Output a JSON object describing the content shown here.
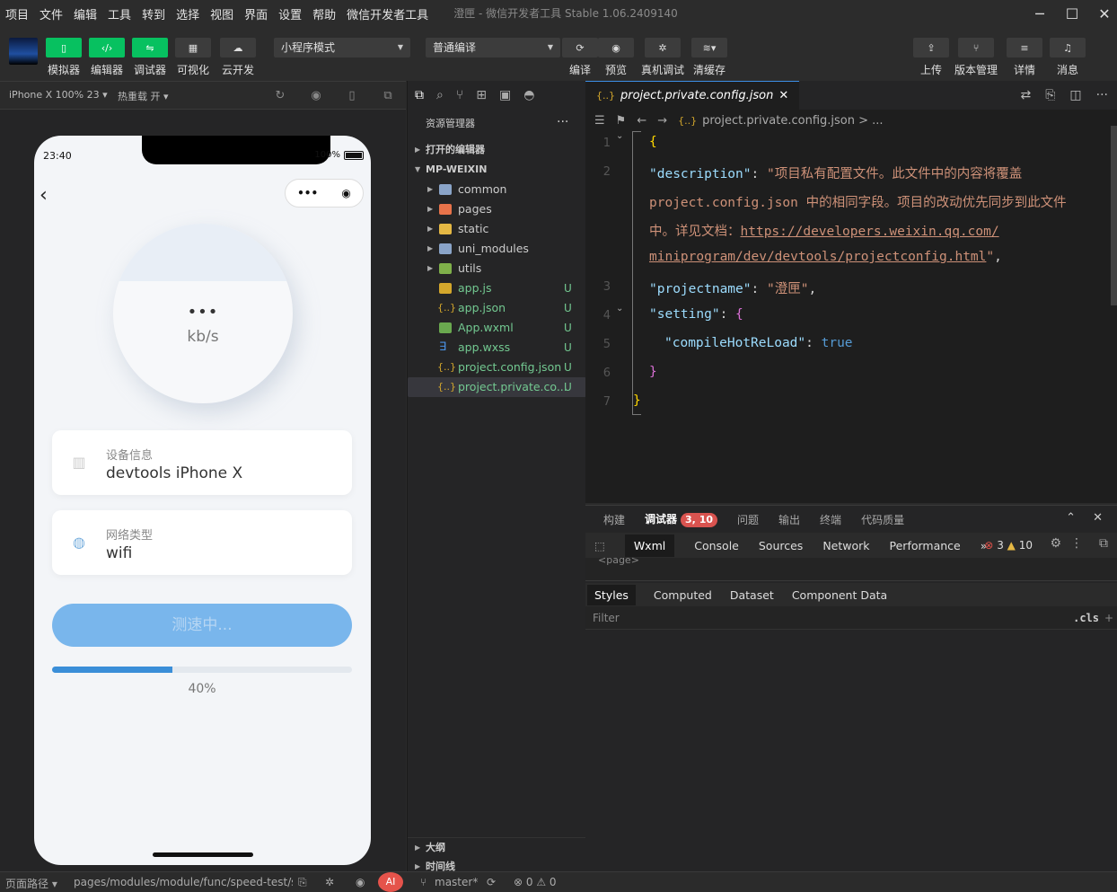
{
  "menu": [
    "项目",
    "文件",
    "编辑",
    "工具",
    "转到",
    "选择",
    "视图",
    "界面",
    "设置",
    "帮助",
    "微信开发者工具"
  ],
  "window_title": "澄匣 - 微信开发者工具 Stable 1.06.2409140",
  "toolbar": {
    "buttons": [
      "模拟器",
      "编辑器",
      "调试器",
      "可视化",
      "云开发"
    ],
    "mode_select": "小程序模式",
    "compile_select": "普通编译",
    "actions": [
      "编译",
      "预览",
      "真机调试",
      "清缓存"
    ],
    "right_actions": [
      "上传",
      "版本管理",
      "详情",
      "消息"
    ]
  },
  "simulator": {
    "device": "iPhone X 100% 23 ▾",
    "hotreload": "热重载 开 ▾"
  },
  "phone": {
    "time": "23:40",
    "battery": "100%",
    "speed_value": "•••",
    "speed_unit": "kb/s",
    "device_label": "设备信息",
    "device_value": "devtools iPhone X",
    "network_label": "网络类型",
    "network_value": "wifi",
    "test_button": "测速中...",
    "progress": 0.4,
    "progress_text": "40%"
  },
  "explorer": {
    "header": "资源管理器",
    "open_editors": "打开的编辑器",
    "project": "MP-WEIXIN",
    "folders": [
      "common",
      "pages",
      "static",
      "uni_modules",
      "utils"
    ],
    "files": [
      {
        "name": "app.js",
        "status": "U"
      },
      {
        "name": "app.json",
        "status": "U"
      },
      {
        "name": "App.wxml",
        "status": "U"
      },
      {
        "name": "app.wxss",
        "status": "U"
      },
      {
        "name": "project.config.json",
        "status": "U"
      },
      {
        "name": "project.private.co...",
        "status": "U"
      }
    ],
    "outline": "大纲",
    "timeline": "时间线"
  },
  "editor": {
    "tab": "project.private.config.json",
    "breadcrumb": "project.private.config.json > ...",
    "line_numbers": [
      "1",
      "2",
      "3",
      "4",
      "5",
      "6",
      "7"
    ],
    "code": {
      "open_brace": "{",
      "desc_key": "\"description\"",
      "colon": ": ",
      "desc_val_1": "\"项目私有配置文件。此文件中的内容将覆盖",
      "desc_val_2": "project.config.json 中的相同字段。项目的改动优先同步到此文件",
      "desc_val_3": "中。详见文档：",
      "desc_url_1": "https://developers.weixin.qq.com/",
      "desc_url_2": "miniprogram/dev/devtools/projectconfig.html",
      "desc_end": "\"",
      "comma": ",",
      "name_key": "\"projectname\"",
      "name_val": "\"澄匣\"",
      "setting_key": "\"setting\"",
      "setting_open": "{",
      "hot_key": "\"compileHotReLoad\"",
      "hot_val": "true",
      "setting_close": "}",
      "close_brace": "}"
    }
  },
  "devtools": {
    "tabs": [
      "构建",
      "调试器",
      "问题",
      "输出",
      "终端",
      "代码质量"
    ],
    "badge": "3, 10",
    "console_tabs": [
      "Wxml",
      "Console",
      "Sources",
      "Network",
      "Performance"
    ],
    "errors": "3",
    "warnings": "10",
    "dom": "<page>",
    "style_tabs": [
      "Styles",
      "Computed",
      "Dataset",
      "Component Data"
    ],
    "filter": "Filter",
    "cls": ".cls"
  },
  "status": {
    "page_path_label": "页面路径 ▾",
    "page_path": "pages/modules/module/func/speed-test/sp...",
    "branch": "master*",
    "problems": "⊗ 0 ⚠ 0"
  },
  "colors": {
    "accent_green": "#07c160",
    "progress": "#3a8ed8",
    "button": "#79b6ec"
  }
}
